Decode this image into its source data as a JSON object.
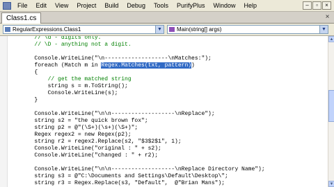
{
  "menubar": {
    "items": [
      "File",
      "Edit",
      "View",
      "Project",
      "Build",
      "Debug",
      "Tools",
      "PurifyPlus",
      "Window",
      "Help"
    ],
    "window_buttons": [
      "–",
      "▫",
      "×"
    ]
  },
  "document_tabs": [
    {
      "label": "Class1.cs",
      "active": true
    }
  ],
  "tab_close": "×",
  "navigation": {
    "type_combo": "RegularExpressions.Class1",
    "member_combo": "Main(string[] args)"
  },
  "editor": {
    "selected_text": "Regex.Matches(txt, pattern)",
    "lines": [
      {
        "text": "        // \\d - digits only.",
        "kind": "comment"
      },
      {
        "text": "        // \\D - anything not a digit.",
        "kind": "comment"
      },
      {
        "text": "",
        "kind": "code"
      },
      {
        "text": "        Console.WriteLine(\"\\n-------------------\\nMatches:\");",
        "kind": "code"
      },
      {
        "text": "        foreach (Match m in ",
        "kind": "code",
        "selection": "Regex.Matches(txt, pattern)",
        "after": ")"
      },
      {
        "text": "        {",
        "kind": "code"
      },
      {
        "text": "            // get the matched string",
        "kind": "comment"
      },
      {
        "text": "            string s = m.ToString();",
        "kind": "code"
      },
      {
        "text": "            Console.WriteLine(s);",
        "kind": "code"
      },
      {
        "text": "        }",
        "kind": "code"
      },
      {
        "text": "",
        "kind": "code"
      },
      {
        "text": "        Console.WriteLine(\"\\n\\n-------------------\\nReplace\");",
        "kind": "code"
      },
      {
        "text": "        string s2 = \"the quick brown fox\";",
        "kind": "code"
      },
      {
        "text": "        string p2 = @\"(\\S+)(\\s+)(\\S+)\";",
        "kind": "code"
      },
      {
        "text": "        Regex regex2 = new Regex(p2);",
        "kind": "code"
      },
      {
        "text": "        string r2 = regex2.Replace(s2, \"$3$2$1\", 1);",
        "kind": "code"
      },
      {
        "text": "        Console.WriteLine(\"original : \" + s2);",
        "kind": "code"
      },
      {
        "text": "        Console.WriteLine(\"changed : \" + r2);",
        "kind": "code"
      },
      {
        "text": "",
        "kind": "code"
      },
      {
        "text": "        Console.WriteLine(\"\\n\\n-------------------\\nReplace Directory Name\");",
        "kind": "code"
      },
      {
        "text": "        string s3 = @\"C:\\Documents and Settings\\Default\\Desktop\\\";",
        "kind": "code"
      },
      {
        "text": "        string r3 = Regex.Replace(s3, \"Default\",  @\"Brian Mans\");",
        "kind": "code"
      }
    ]
  },
  "scrollbar": {
    "up": "▲",
    "down": "▼",
    "position": 0.45
  }
}
